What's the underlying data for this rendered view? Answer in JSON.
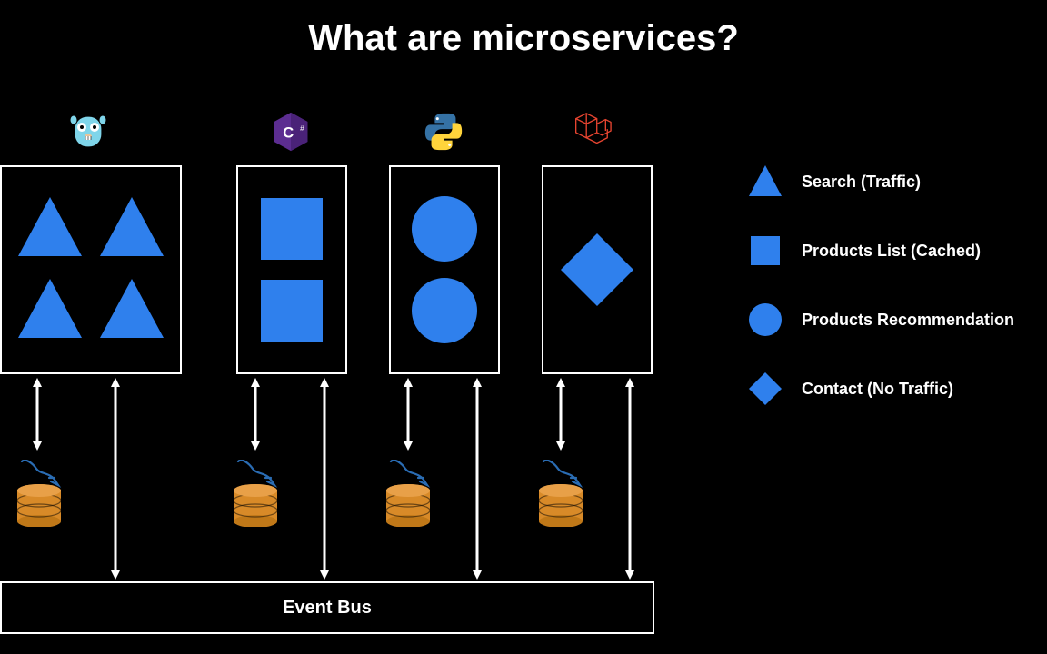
{
  "title": "What are microservices?",
  "colors": {
    "shape_blue": "#2F80ED",
    "db_orange": "#D88A28",
    "dolphin_blue": "#2A6CB3",
    "csharp_purple": "#5C2D91",
    "python_blue": "#3572A5",
    "python_yellow": "#FFD43B",
    "laravel_red": "#E74430",
    "go_blue": "#7FD5EA"
  },
  "services": [
    {
      "id": "search",
      "tech": "go",
      "instances": 4,
      "shape": "triangle"
    },
    {
      "id": "products-list",
      "tech": "csharp",
      "instances": 2,
      "shape": "square"
    },
    {
      "id": "products-reco",
      "tech": "python",
      "instances": 2,
      "shape": "circle"
    },
    {
      "id": "contact",
      "tech": "laravel",
      "instances": 1,
      "shape": "diamond"
    }
  ],
  "legend": [
    {
      "shape": "triangle",
      "label": "Search (Traffic)"
    },
    {
      "shape": "square",
      "label": "Products List (Cached)"
    },
    {
      "shape": "circle",
      "label": "Products Recommendation"
    },
    {
      "shape": "diamond",
      "label": "Contact (No Traffic)"
    }
  ],
  "event_bus_label": "Event Bus"
}
